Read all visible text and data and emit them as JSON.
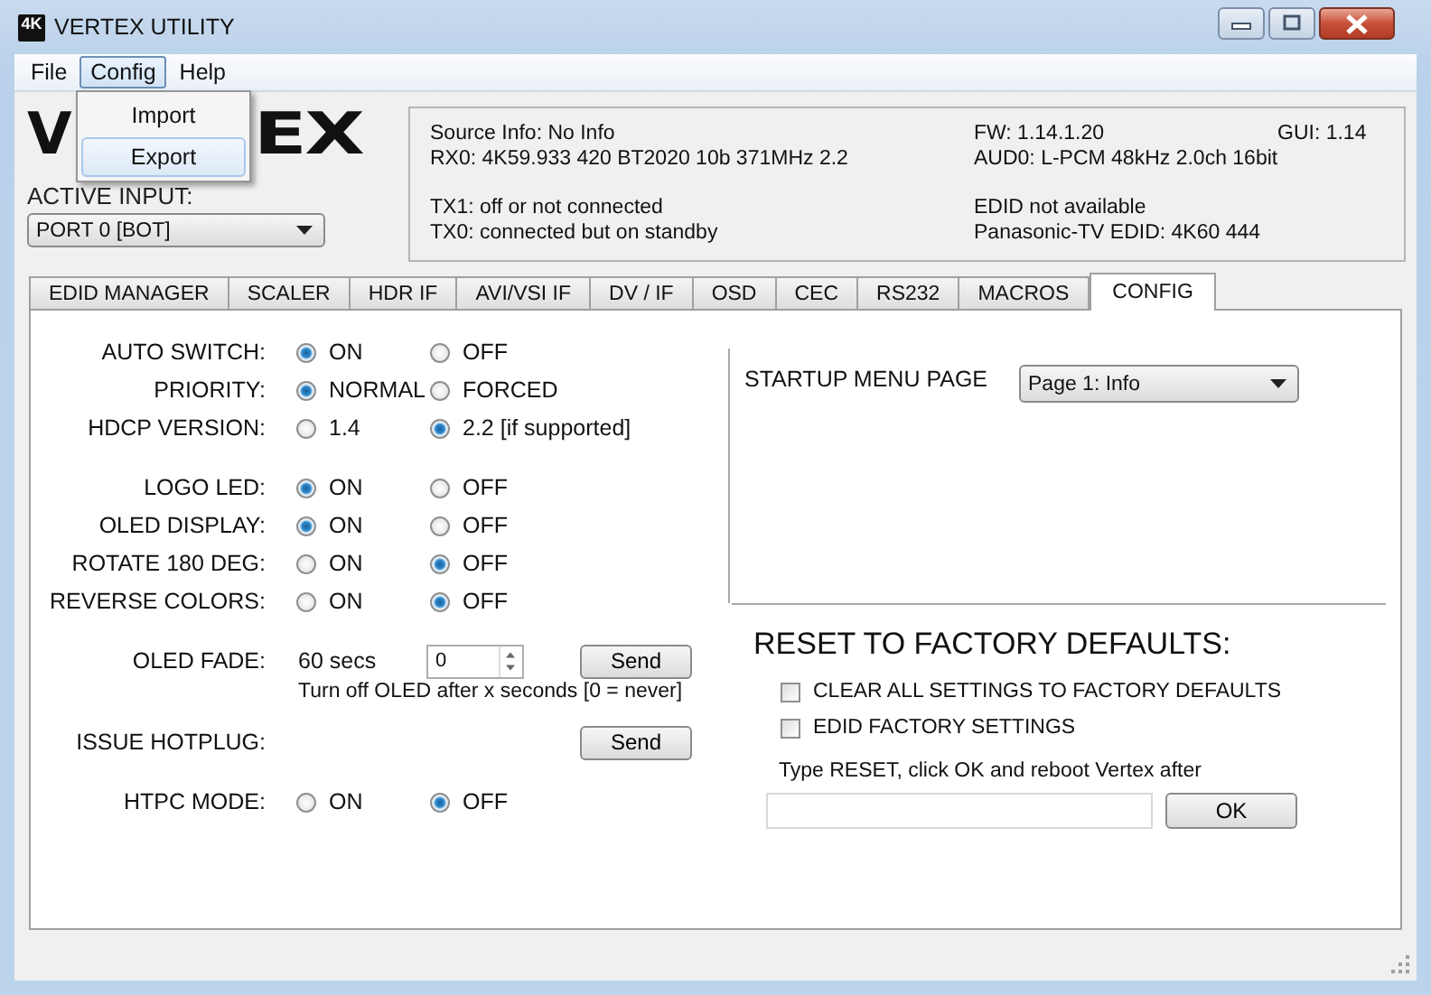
{
  "window": {
    "title": "VERTEX UTILITY",
    "app_icon": "4K"
  },
  "menu_bar": [
    {
      "label": "File",
      "selected": false
    },
    {
      "label": "Config",
      "selected": true
    },
    {
      "label": "Help",
      "selected": false
    }
  ],
  "open_menu": {
    "items": [
      {
        "label": "Import",
        "selected": false
      },
      {
        "label": "Export",
        "selected": true
      }
    ]
  },
  "logo": {
    "parts": [
      "V",
      "EX"
    ]
  },
  "active_input": {
    "label": "ACTIVE INPUT:",
    "value": "PORT 0 [BOT]"
  },
  "info": {
    "blocks": [
      [
        [
          "Source Info: No Info",
          "FW: 1.14.1.20",
          "GUI: 1.14"
        ],
        [
          "RX0: 4K59.933 420 BT2020 10b 371MHz 2.2",
          "AUD0: L-PCM 48kHz 2.0ch 16bit"
        ]
      ],
      [
        [
          "TX1: off or not connected",
          "EDID not available"
        ],
        [
          "TX0: connected but on standby",
          "Panasonic-TV EDID: 4K60 444"
        ]
      ]
    ]
  },
  "tabs": [
    {
      "label": "EDID MANAGER",
      "selected": false
    },
    {
      "label": "SCALER",
      "selected": false
    },
    {
      "label": "HDR IF",
      "selected": false
    },
    {
      "label": "AVI/VSI IF",
      "selected": false
    },
    {
      "label": "DV / IF",
      "selected": false
    },
    {
      "label": "OSD",
      "selected": false
    },
    {
      "label": "CEC",
      "selected": false
    },
    {
      "label": "RS232",
      "selected": false
    },
    {
      "label": "MACROS",
      "selected": false
    },
    {
      "label": "CONFIG",
      "selected": true
    }
  ],
  "setting_groups": [
    [
      {
        "kind": "radio",
        "label": "AUTO SWITCH:",
        "options": [
          {
            "label": "ON",
            "selected": true
          },
          {
            "label": "OFF",
            "selected": false
          }
        ]
      },
      {
        "kind": "radio",
        "label": "PRIORITY:",
        "options": [
          {
            "label": "NORMAL",
            "selected": true
          },
          {
            "label": "FORCED",
            "selected": false
          }
        ]
      },
      {
        "kind": "radio",
        "label": "HDCP VERSION:",
        "options": [
          {
            "label": "1.4",
            "selected": false
          },
          {
            "label": "2.2 [if supported]",
            "selected": true
          }
        ]
      }
    ],
    [
      {
        "kind": "radio",
        "label": "LOGO LED:",
        "options": [
          {
            "label": "ON",
            "selected": true
          },
          {
            "label": "OFF",
            "selected": false
          }
        ]
      },
      {
        "kind": "radio",
        "label": "OLED DISPLAY:",
        "options": [
          {
            "label": "ON",
            "selected": true
          },
          {
            "label": "OFF",
            "selected": false
          }
        ]
      },
      {
        "kind": "radio",
        "label": "ROTATE 180 DEG:",
        "options": [
          {
            "label": "ON",
            "selected": false
          },
          {
            "label": "OFF",
            "selected": true
          }
        ]
      },
      {
        "kind": "radio",
        "label": "REVERSE COLORS:",
        "options": [
          {
            "label": "ON",
            "selected": false
          },
          {
            "label": "OFF",
            "selected": true
          }
        ]
      }
    ],
    [
      {
        "kind": "fade",
        "label": "OLED FADE:",
        "reading": "60 secs",
        "value": "0",
        "button": "Send",
        "hint": "Turn off OLED after x seconds [0 = never]"
      }
    ],
    [
      {
        "kind": "button",
        "label": "ISSUE HOTPLUG:",
        "button": "Send"
      }
    ],
    [
      {
        "kind": "radio",
        "label": "HTPC MODE:",
        "options": [
          {
            "label": "ON",
            "selected": false
          },
          {
            "label": "OFF",
            "selected": true
          }
        ]
      }
    ]
  ],
  "startup_menu": {
    "label": "STARTUP MENU PAGE",
    "value": "Page 1: Info"
  },
  "reset": {
    "title": "RESET TO FACTORY DEFAULTS:",
    "options": [
      {
        "label": "CLEAR ALL SETTINGS TO FACTORY DEFAULTS",
        "checked": false
      },
      {
        "label": "EDID FACTORY SETTINGS",
        "checked": false
      }
    ],
    "hint": "Type RESET, click OK and reboot Vertex after",
    "button": "OK"
  }
}
